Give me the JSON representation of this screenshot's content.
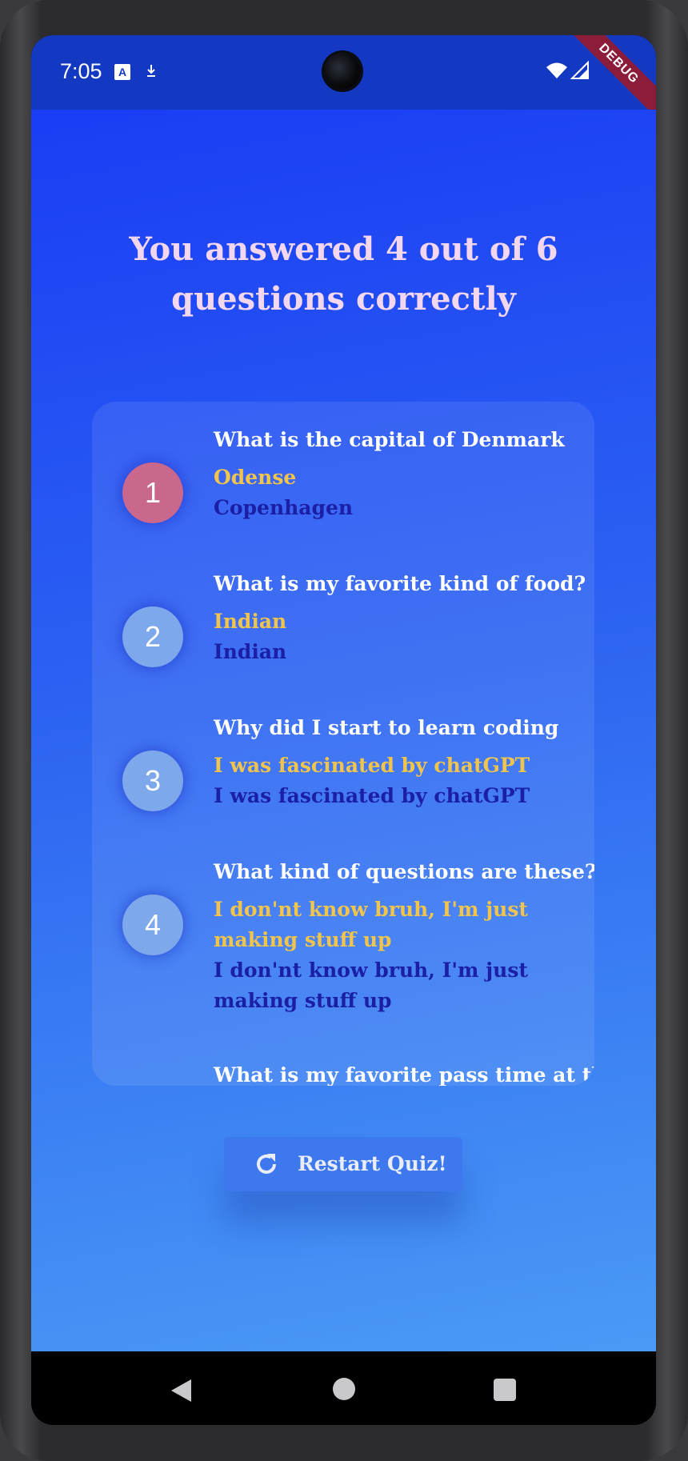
{
  "status_bar": {
    "time": "7:05",
    "debug_label": "DEBUG"
  },
  "result": {
    "title_line1": "You answered 4 out of 6",
    "title_line2": "questions correctly"
  },
  "summary": [
    {
      "number": "1",
      "question": "What is the capital of Denmark",
      "user_answer": "Odense",
      "correct_answer": "Copenhagen",
      "is_correct": false
    },
    {
      "number": "2",
      "question": "What is my favorite kind of food?",
      "user_answer": "Indian",
      "correct_answer": "Indian",
      "is_correct": true
    },
    {
      "number": "3",
      "question": "Why did I start to learn coding",
      "user_answer": "I was fascinated by chatGPT",
      "correct_answer": "I was fascinated by chatGPT",
      "is_correct": true
    },
    {
      "number": "4",
      "question": "What kind of questions are these?",
      "user_answer": "I don'nt know bruh, I'm just making stuff up",
      "correct_answer": "I don'nt know bruh, I'm just making stuff up",
      "is_correct": true
    },
    {
      "question": "What is my favorite pass time at the"
    }
  ],
  "restart_button": {
    "label": "Restart Quiz!",
    "icon": "refresh-icon"
  },
  "colors": {
    "user_answer": "#f1c44c",
    "correct_answer": "#1b1fa6",
    "badge_correct": "#7da8eb",
    "badge_wrong": "#c9678c"
  }
}
